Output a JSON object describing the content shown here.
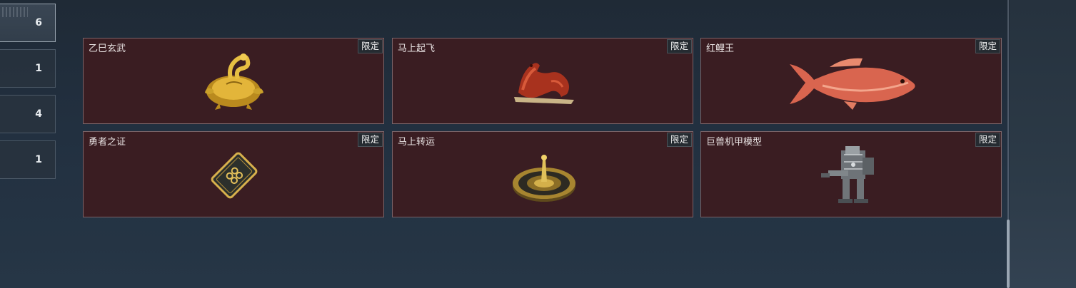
{
  "sidebar": {
    "tabs": [
      {
        "count": "6",
        "active": true
      },
      {
        "count": "1",
        "active": false
      },
      {
        "count": "4",
        "active": false
      },
      {
        "count": "1",
        "active": false
      }
    ]
  },
  "items": [
    {
      "name": "乙巳玄武",
      "badge": "限定",
      "icon": "gold-tortoise-snake-icon"
    },
    {
      "name": "马上起飞",
      "badge": "限定",
      "icon": "red-horse-icon"
    },
    {
      "name": "红鲤王",
      "badge": "限定",
      "icon": "red-carp-icon"
    },
    {
      "name": "勇者之证",
      "badge": "限定",
      "icon": "card-emblem-icon"
    },
    {
      "name": "马上转运",
      "badge": "限定",
      "icon": "gold-compass-icon"
    },
    {
      "name": "巨兽机甲模型",
      "badge": "限定",
      "icon": "mech-model-icon"
    }
  ],
  "colors": {
    "card_bg": "#3a1d22",
    "card_border": "#7a6468",
    "background": "#223040"
  }
}
